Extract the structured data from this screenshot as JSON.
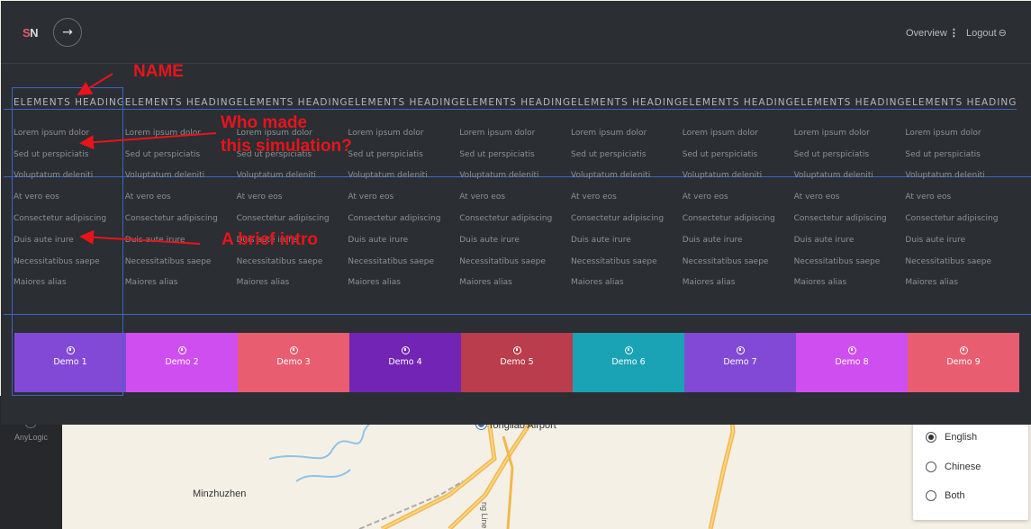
{
  "header": {
    "logo": {
      "s": "S",
      "n": "N"
    },
    "nav_overview": "Overview",
    "nav_logout": "Logout"
  },
  "columns": [
    {
      "heading": "ELEMENTS HEADING",
      "items": [
        "Lorem ipsum dolor",
        "Sed ut perspiciatis",
        "Voluptatum deleniti",
        "At vero eos",
        "Consectetur adipiscing",
        "Duis aute irure",
        "Necessitatibus saepe",
        "Maiores alias"
      ]
    },
    {
      "heading": "ELEMENTS HEADING",
      "items": [
        "Lorem ipsum dolor",
        "Sed ut perspiciatis",
        "Voluptatum deleniti",
        "At vero eos",
        "Consectetur adipiscing",
        "Duis aute irure",
        "Necessitatibus saepe",
        "Maiores alias"
      ]
    },
    {
      "heading": "ELEMENTS HEADING",
      "items": [
        "Lorem ipsum dolor",
        "Sed ut perspiciatis",
        "Voluptatum deleniti",
        "At vero eos",
        "Consectetur adipiscing",
        "Duis aute irure",
        "Necessitatibus saepe",
        "Maiores alias"
      ]
    },
    {
      "heading": "ELEMENTS HEADING",
      "items": [
        "Lorem ipsum dolor",
        "Sed ut perspiciatis",
        "Voluptatum deleniti",
        "At vero eos",
        "Consectetur adipiscing",
        "Duis aute irure",
        "Necessitatibus saepe",
        "Maiores alias"
      ]
    },
    {
      "heading": "ELEMENTS HEADING",
      "items": [
        "Lorem ipsum dolor",
        "Sed ut perspiciatis",
        "Voluptatum deleniti",
        "At vero eos",
        "Consectetur adipiscing",
        "Duis aute irure",
        "Necessitatibus saepe",
        "Maiores alias"
      ]
    },
    {
      "heading": "ELEMENTS HEADING",
      "items": [
        "Lorem ipsum dolor",
        "Sed ut perspiciatis",
        "Voluptatum deleniti",
        "At vero eos",
        "Consectetur adipiscing",
        "Duis aute irure",
        "Necessitatibus saepe",
        "Maiores alias"
      ]
    },
    {
      "heading": "ELEMENTS HEADING",
      "items": [
        "Lorem ipsum dolor",
        "Sed ut perspiciatis",
        "Voluptatum deleniti",
        "At vero eos",
        "Consectetur adipiscing",
        "Duis aute irure",
        "Necessitatibus saepe",
        "Maiores alias"
      ]
    },
    {
      "heading": "ELEMENTS HEADING",
      "items": [
        "Lorem ipsum dolor",
        "Sed ut perspiciatis",
        "Voluptatum deleniti",
        "At vero eos",
        "Consectetur adipiscing",
        "Duis aute irure",
        "Necessitatibus saepe",
        "Maiores alias"
      ]
    },
    {
      "heading": "ELEMENTS HEADING",
      "items": [
        "Lorem ipsum dolor",
        "Sed ut perspiciatis",
        "Voluptatum deleniti",
        "At vero eos",
        "Consectetur adipiscing",
        "Duis aute irure",
        "Necessitatibus saepe",
        "Maiores alias"
      ]
    }
  ],
  "demos": [
    {
      "label": "Demo 1",
      "color": "#8249d6"
    },
    {
      "label": "Demo 2",
      "color": "#cf4ef0"
    },
    {
      "label": "Demo 3",
      "color": "#e85d70"
    },
    {
      "label": "Demo 4",
      "color": "#7224b4"
    },
    {
      "label": "Demo 5",
      "color": "#b93d4c"
    },
    {
      "label": "Demo 6",
      "color": "#19a3b5"
    },
    {
      "label": "Demo 7",
      "color": "#8249d6"
    },
    {
      "label": "Demo 8",
      "color": "#cf4ef0"
    },
    {
      "label": "Demo 9",
      "color": "#e85d70"
    }
  ],
  "annotations": {
    "name": "NAME",
    "who_line1": "Who made",
    "who_line2": "this simulation?",
    "intro": "A brief intro"
  },
  "background": {
    "sidebar_label": "AnyLogic",
    "map_town": "Minzhuzhen",
    "map_airport": "Tongliao Airport",
    "map_road": "ng Line"
  },
  "language": {
    "options": [
      {
        "label": "English",
        "selected": true
      },
      {
        "label": "Chinese",
        "selected": false
      },
      {
        "label": "Both",
        "selected": false
      }
    ]
  },
  "colors": {
    "overlay_bg": "#2b2e33",
    "accent_line": "#3c66c4",
    "annotation": "#e8141b"
  }
}
